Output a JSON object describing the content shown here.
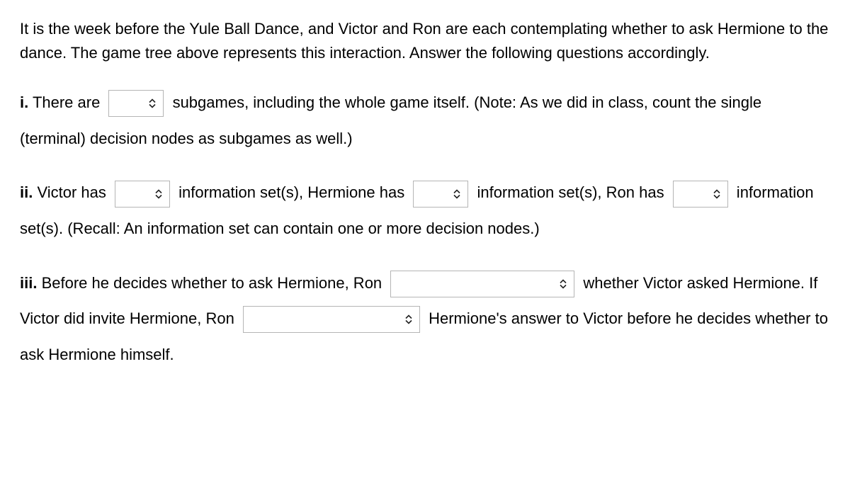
{
  "intro": "It is the week before the Yule Ball Dance, and Victor and Ron are each contemplating whether to ask Hermione to the dance. The game tree above represents this interaction. Answer the following questions accordingly.",
  "q1": {
    "label": "i.",
    "text_before": " There are ",
    "text_after": " subgames, including the whole game itself. (Note: As we did in class, count the single (terminal) decision nodes as subgames as well.)"
  },
  "q2": {
    "label": "ii.",
    "text1": "  Victor has ",
    "text2": " information set(s), Hermione has ",
    "text3": " information set(s), Ron has ",
    "text4": " information set(s). (Recall: An information set can contain one or more decision nodes.)"
  },
  "q3": {
    "label": "iii.",
    "text1": " Before he decides whether to ask Hermione, Ron ",
    "text2": " whether Victor asked Hermione. If Victor did invite Hermione, Ron ",
    "text3": " Hermione's answer to Victor before he decides whether to ask Hermione himself."
  }
}
